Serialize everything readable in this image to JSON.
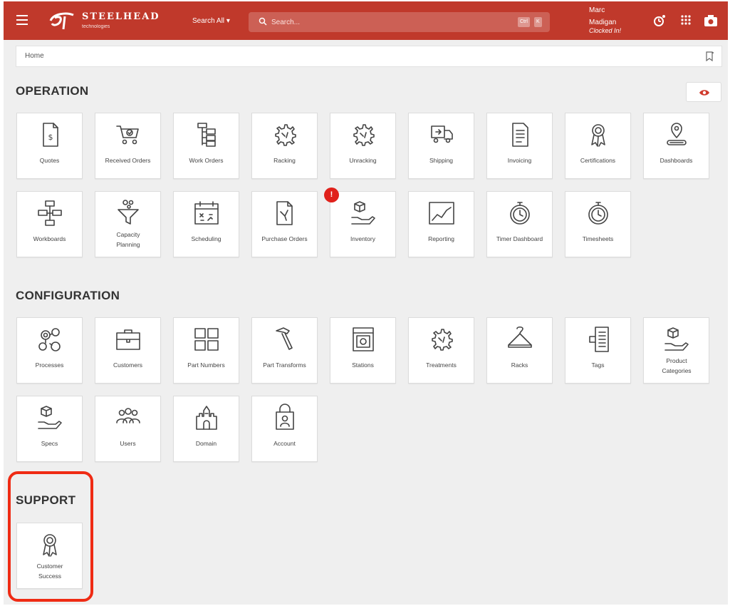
{
  "header": {
    "brand": "STEELHEAD",
    "brand_sub": "technologies",
    "search_scope": "Search All",
    "search_placeholder": "Search...",
    "kbd_ctrl": "Ctrl",
    "kbd_k": "K",
    "user_first": "Marc",
    "user_last": "Madigan",
    "clock_status": "Clocked In!",
    "accent_color": "#c0392b"
  },
  "breadcrumb": {
    "home": "Home"
  },
  "sections": {
    "operation": "OPERATION",
    "configuration": "CONFIGURATION",
    "support": "SUPPORT"
  },
  "operation_tiles": [
    {
      "label": "Quotes",
      "icon": "quote-document-icon"
    },
    {
      "label": "Received Orders",
      "icon": "shopping-cart-icon"
    },
    {
      "label": "Work Orders",
      "icon": "hierarchy-icon"
    },
    {
      "label": "Racking",
      "icon": "gear-icon"
    },
    {
      "label": "Unracking",
      "icon": "gear-icon"
    },
    {
      "label": "Shipping",
      "icon": "truck-icon"
    },
    {
      "label": "Invoicing",
      "icon": "invoice-icon"
    },
    {
      "label": "Certifications",
      "icon": "award-icon"
    },
    {
      "label": "Dashboards",
      "icon": "location-pin-icon"
    },
    {
      "label": "Workboards",
      "icon": "flowchart-icon"
    },
    {
      "label": "Capacity Planning",
      "icon": "funnel-icon"
    },
    {
      "label": "Scheduling",
      "icon": "calendar-icon"
    },
    {
      "label": "Purchase Orders",
      "icon": "document-arrows-icon"
    },
    {
      "label": "Inventory",
      "icon": "hand-box-icon"
    },
    {
      "label": "Reporting",
      "icon": "line-chart-icon"
    },
    {
      "label": "Timer Dashboard",
      "icon": "stopwatch-icon"
    },
    {
      "label": "Timesheets",
      "icon": "stopwatch-icon"
    }
  ],
  "inventory_badge": "!",
  "configuration_tiles": [
    {
      "label": "Processes",
      "icon": "gears-icon"
    },
    {
      "label": "Customers",
      "icon": "briefcase-icon"
    },
    {
      "label": "Part Numbers",
      "icon": "grid-icon"
    },
    {
      "label": "Part Transforms",
      "icon": "hammer-icon"
    },
    {
      "label": "Stations",
      "icon": "station-icon"
    },
    {
      "label": "Treatments",
      "icon": "gear-icon"
    },
    {
      "label": "Racks",
      "icon": "hanger-icon"
    },
    {
      "label": "Tags",
      "icon": "tag-icon"
    },
    {
      "label": "Product Categories",
      "icon": "hand-box-icon"
    },
    {
      "label": "Specs",
      "icon": "hand-box-icon"
    },
    {
      "label": "Users",
      "icon": "users-icon"
    },
    {
      "label": "Domain",
      "icon": "castle-icon"
    },
    {
      "label": "Account",
      "icon": "account-icon"
    }
  ],
  "support_tiles": [
    {
      "label": "Customer Success",
      "icon": "award-icon"
    }
  ]
}
